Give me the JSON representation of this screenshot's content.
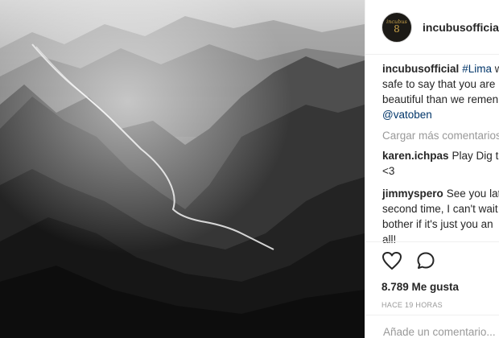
{
  "post": {
    "username": "incubusofficial",
    "avatar_text_top": "incubus",
    "avatar_text_num": "8",
    "caption_user": "incubusofficial",
    "caption_hashtag": "#Lima",
    "caption_text_1": " w",
    "caption_line_2": "safe to say that you are",
    "caption_line_3": "beautiful than we remen",
    "caption_mention": "@vatoben",
    "load_more": "Cargar más comentarios",
    "comments": [
      {
        "user": "karen.ichpas",
        "line_1": "Play Dig to",
        "line_2": "<3"
      },
      {
        "user": "jimmyspero",
        "line_1": "See you lat",
        "line_2": "second time, I can't wait",
        "line_3": "bother if it's just you an",
        "line_4": "all!"
      }
    ],
    "likes": "8.789 Me gusta",
    "timestamp": "HACE 19 HORAS",
    "add_comment_placeholder": "Añade un comentario..."
  },
  "icons": {
    "like": "heart-icon",
    "comment": "comment-bubble-icon"
  },
  "colors": {
    "link": "#003569",
    "muted": "#999999",
    "text": "#262626"
  }
}
